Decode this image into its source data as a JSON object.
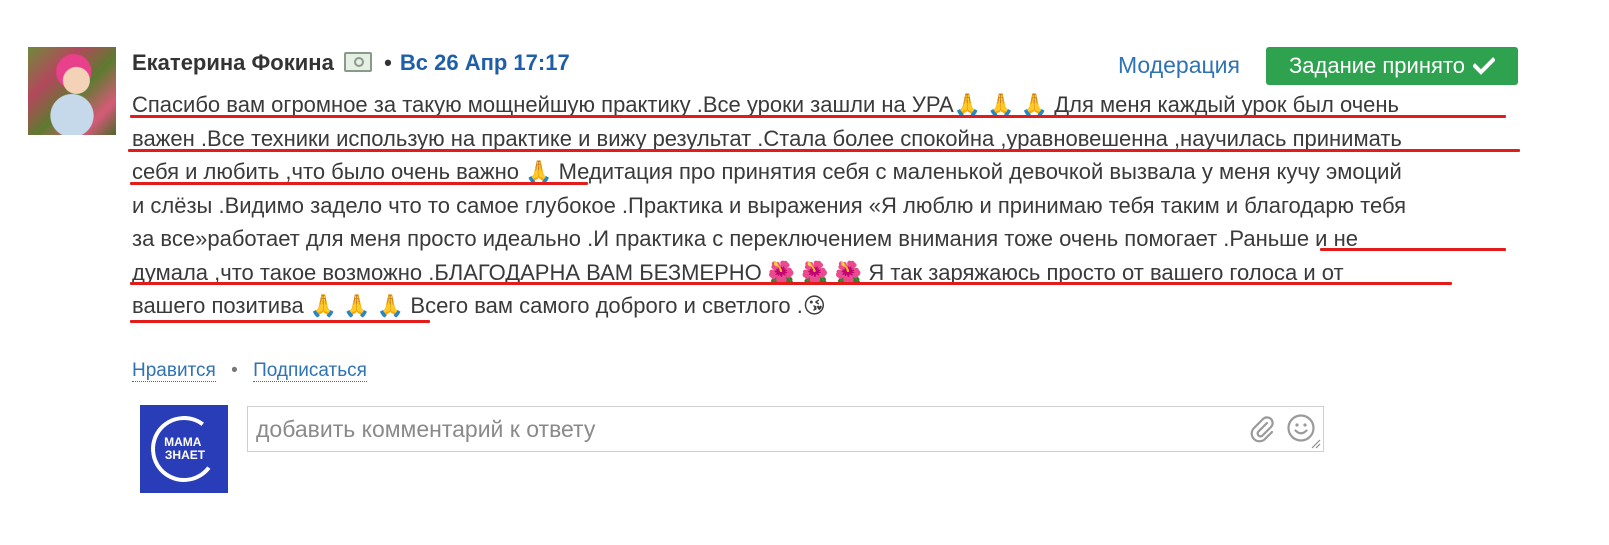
{
  "post": {
    "author": "Екатерина Фокина",
    "separator": "•",
    "date": "Вс 26 Апр 17:17",
    "moderation_label": "Модерация",
    "accept_label": "Задание принято",
    "lines": [
      "Спасибо вам огромное за такую мощнейшую практику .Все уроки зашли на УРА🙏 🙏 🙏 Для меня каждый урок был очень",
      "важен .Все техники использую на практике и вижу результат .Стала более спокойна ,уравновешенна ,научилась принимать",
      "себя и любить ,что было очень важно 🙏 Медитация про принятия себя с маленькой девочкой вызвала у меня кучу эмоций",
      "и слёзы .Видимо задело что то самое глубокое .Практика и выражения «Я люблю и принимаю тебя таким и благодарю тебя",
      "за все»работает для меня просто идеально .И практика с переключением внимания тоже очень помогает .Раньше и не",
      "думала ,что такое возможно .БЛАГОДАРНА ВАМ БЕЗМЕРНО 🌺 🌺 🌺 Я так заряжаюсь просто от вашего голоса и от",
      "вашего позитива 🙏 🙏 🙏 Всего вам самого доброго и светлого .😘"
    ]
  },
  "actions": {
    "like_label": "Нравится",
    "dot": "•",
    "subscribe_label": "Подписаться"
  },
  "logo": {
    "line1": "МАМА",
    "line2": "ЗНАЕТ"
  },
  "comment": {
    "placeholder": "добавить комментарий к ответу"
  },
  "icons": {
    "money": "money-icon",
    "check": "check-icon",
    "attach": "paperclip-icon",
    "emoji": "smile-icon"
  },
  "colors": {
    "accent_blue": "#2f72b5",
    "date_blue": "#1f5fa8",
    "accept_green": "#2ea24f",
    "highlight_red": "#e31b1b",
    "logo_blue": "#2a3db8"
  }
}
